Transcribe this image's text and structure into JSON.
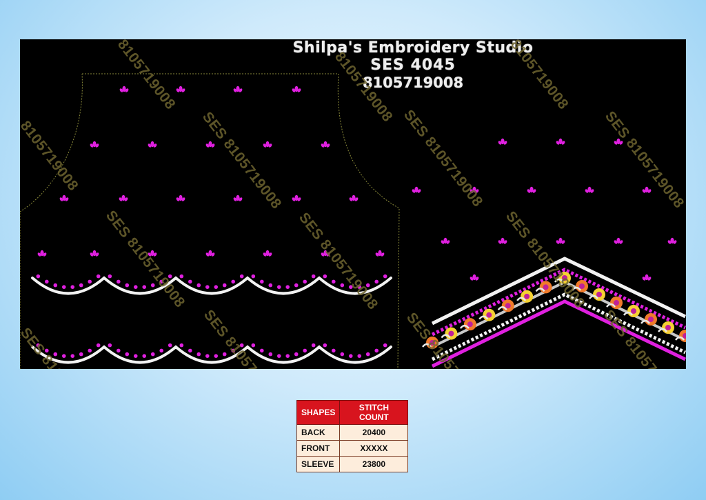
{
  "title": {
    "line1": "Shilpa's Embroidery Studio",
    "line2": "SES  4045",
    "line3": "8105719008"
  },
  "watermark": {
    "text_full": "SES 8105719008",
    "text_number": "8105719008"
  },
  "colors": {
    "background": "#000000",
    "motif": "#e020e0",
    "scallop": "#f2f2f2",
    "table_header": "#d8141e",
    "table_cell": "#fdeddc",
    "watermark": "#6e6430"
  },
  "table": {
    "headers": [
      "SHAPES",
      "STITCH COUNT"
    ],
    "rows": [
      {
        "shape": "BACK",
        "count": "20400"
      },
      {
        "shape": "FRONT",
        "count": "XXXXX"
      },
      {
        "shape": "SLEEVE",
        "count": "23800"
      }
    ]
  }
}
